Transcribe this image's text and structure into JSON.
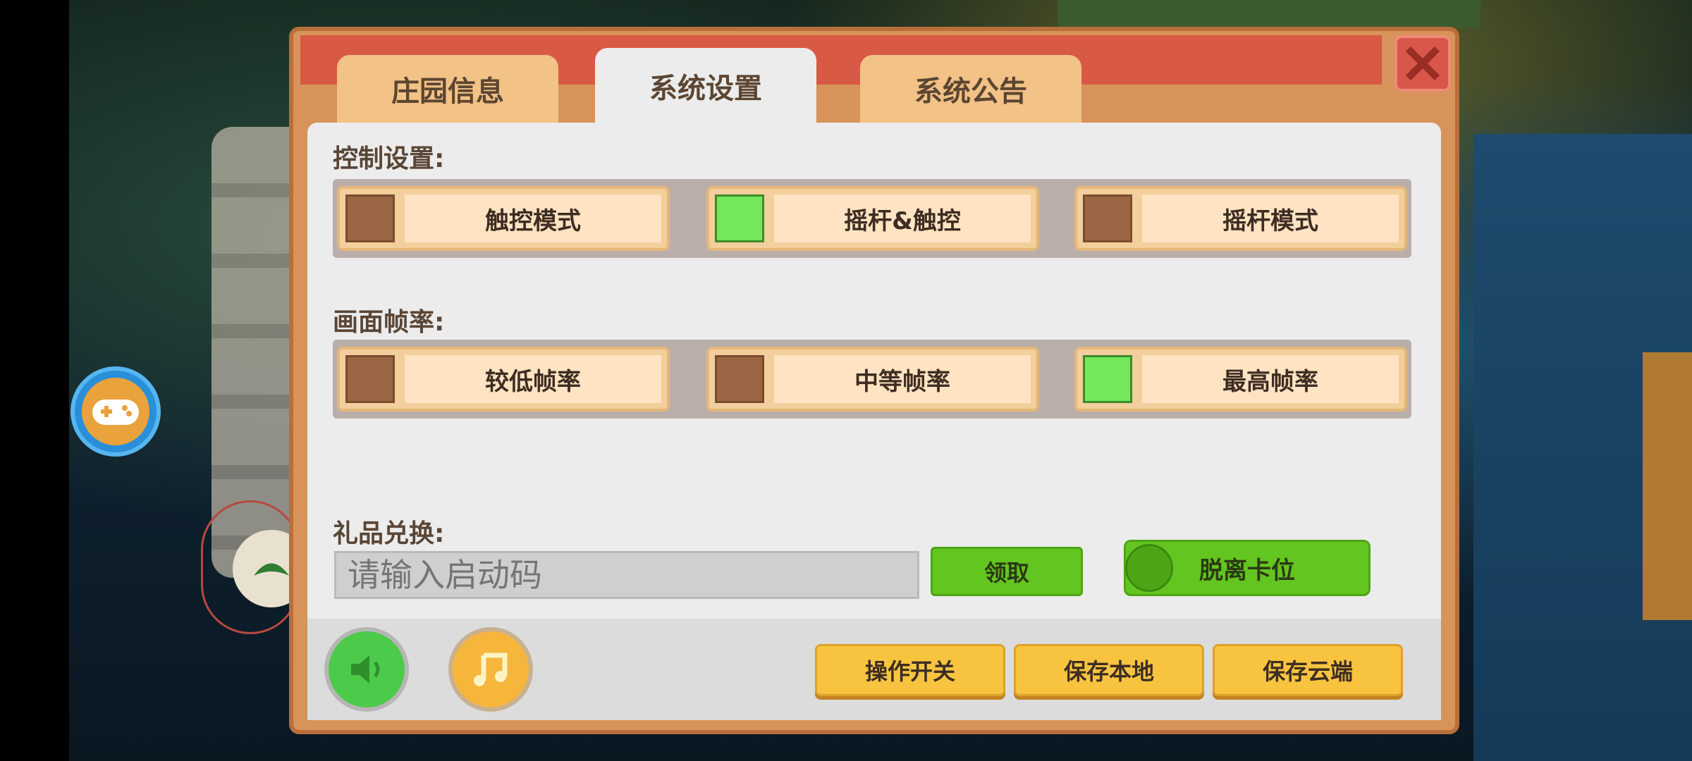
{
  "tabs": [
    {
      "label": "庄园信息",
      "active": false
    },
    {
      "label": "系统设置",
      "active": true
    },
    {
      "label": "系统公告",
      "active": false
    }
  ],
  "control": {
    "title": "控制设置:",
    "options": [
      {
        "label": "触控模式",
        "checked": false
      },
      {
        "label": "摇杆&触控",
        "checked": true
      },
      {
        "label": "摇杆模式",
        "checked": false
      }
    ]
  },
  "framerate": {
    "title": "画面帧率:",
    "options": [
      {
        "label": "较低帧率",
        "checked": false
      },
      {
        "label": "中等帧率",
        "checked": false
      },
      {
        "label": "最高帧率",
        "checked": true
      }
    ]
  },
  "gift": {
    "title": "礼品兑换:",
    "placeholder": "请输入启动码",
    "claim_label": "领取",
    "unstuck_label": "脱离卡位"
  },
  "actions": [
    "操作开关",
    "保存本地",
    "保存云端"
  ],
  "icons": {
    "close": "close-icon",
    "sound": "speaker-icon",
    "music": "music-note-icon",
    "gamepad": "gamepad-icon"
  },
  "colors": {
    "checked": "#74e85a",
    "unchecked": "#9b6643",
    "header": "#d85a45",
    "green_button": "#63c51f",
    "yellow_button": "#f8c440"
  }
}
